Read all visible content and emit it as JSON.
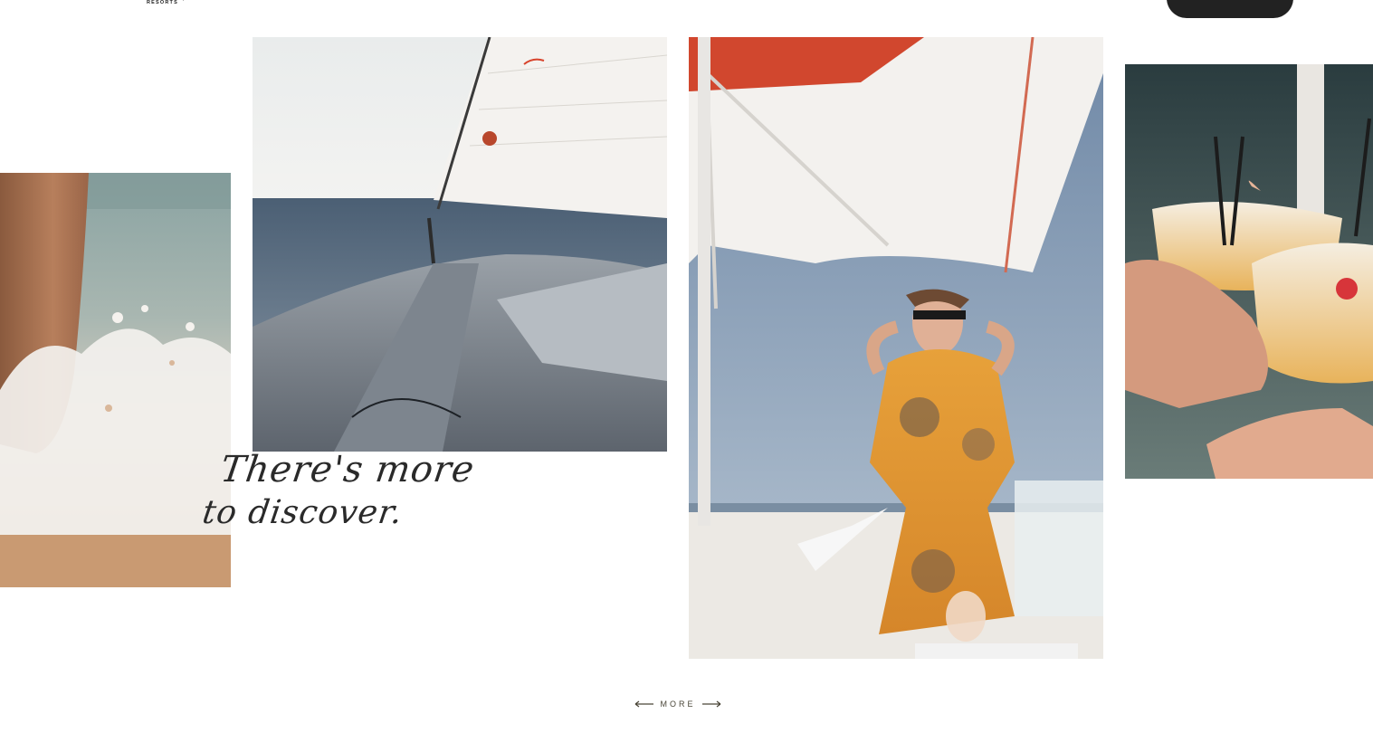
{
  "header": {
    "logo_subtitle": "RESORTS",
    "book_label": ""
  },
  "gallery": {
    "tagline_line1": "There's more",
    "tagline_line2": "to discover.",
    "more_label": "MORE"
  },
  "icons": {
    "menu": "hamburger-menu-icon",
    "prev": "arrow-left-icon",
    "next": "arrow-right-icon"
  },
  "colors": {
    "text": "#2a2a2a",
    "button": "#222222",
    "more": "#4a4638"
  }
}
